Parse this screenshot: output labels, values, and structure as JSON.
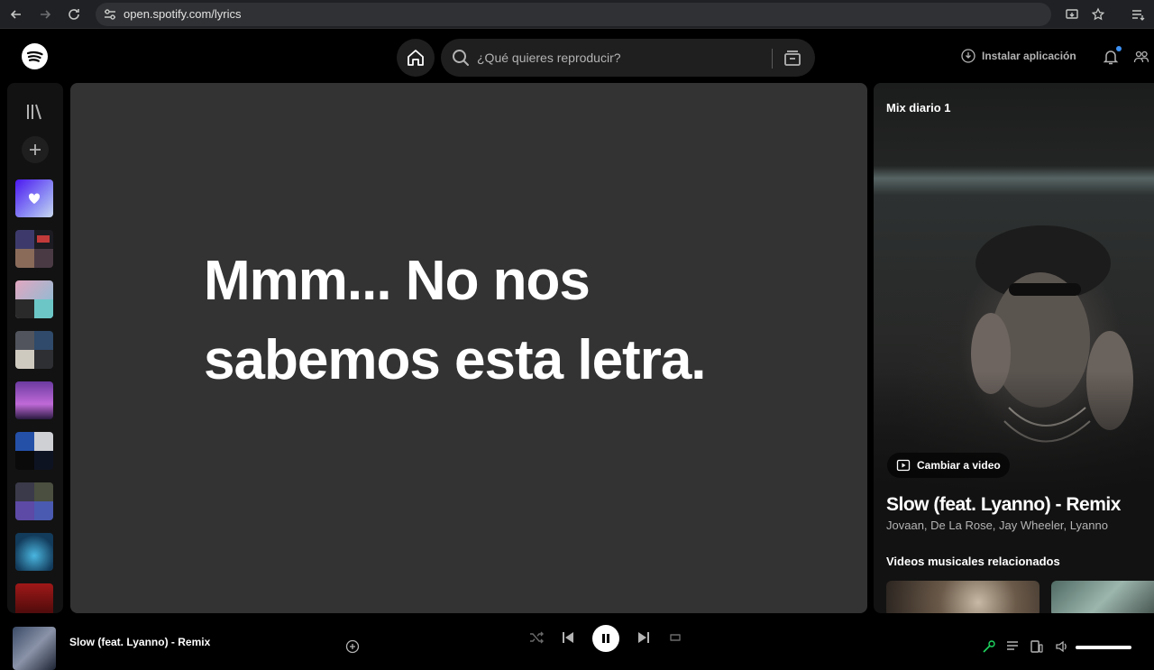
{
  "browser": {
    "url": "open.spotify.com/lyrics"
  },
  "topnav": {
    "search_placeholder": "¿Qué quieres reproducir?",
    "install_label": "Instalar aplicación"
  },
  "lyrics": {
    "message": "Mmm... No nos sabemos esta letra."
  },
  "now_playing_view": {
    "header": "Mix diario 1",
    "change_video_label": "Cambiar a video",
    "song_title": "Slow (feat. Lyanno) - Remix",
    "artists": "Jovaan, De La Rose, Jay Wheeler, Lyanno",
    "related_header": "Videos musicales relacionados"
  },
  "player": {
    "title": "Slow (feat. Lyanno) - Remix"
  },
  "colors": {
    "accent_green": "#1ed760",
    "panel_bg": "#333333",
    "notification_dot": "#3d91f4"
  },
  "sidebar": {
    "items": [
      "liked-songs",
      "playlist-1",
      "playlist-2",
      "playlist-3",
      "playlist-4",
      "playlist-5",
      "playlist-6",
      "playlist-7",
      "playlist-8"
    ]
  }
}
